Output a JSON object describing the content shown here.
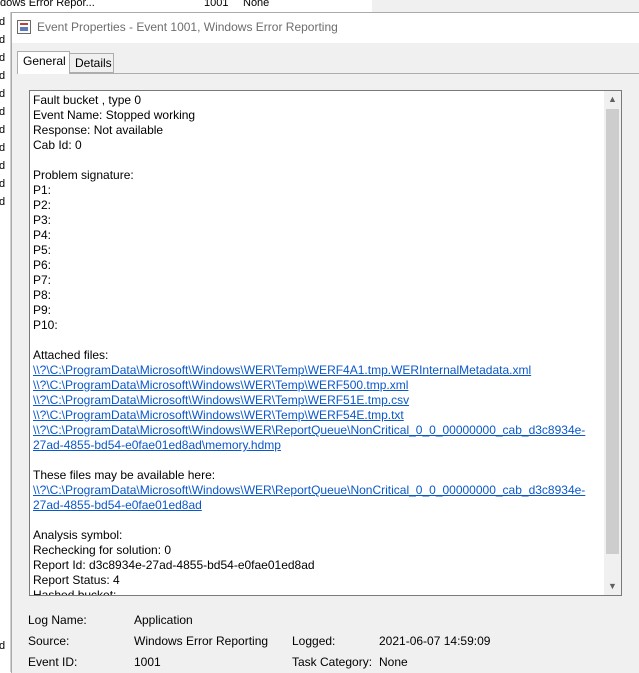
{
  "background": {
    "top_row": {
      "source": "dows Error Repor...",
      "id": "1001",
      "category": "None"
    },
    "left_fragments": [
      "d",
      "d",
      "d",
      "d",
      "d",
      "d",
      "d",
      "d",
      "d",
      "d",
      "d",
      "d"
    ]
  },
  "dialog": {
    "title": "Event Properties - Event 1001, Windows Error Reporting",
    "tabs": [
      {
        "label": "General",
        "active": true
      },
      {
        "label": "Details",
        "active": false
      }
    ]
  },
  "description": {
    "lines_a": [
      "Fault bucket , type 0",
      "Event Name: Stopped working",
      "Response: Not available",
      "Cab Id: 0"
    ],
    "signature_heading": "Problem signature:",
    "signature_lines": [
      "P1:",
      "P2:",
      "P3:",
      "P4:",
      "P5:",
      "P6:",
      "P7:",
      "P8:",
      "P9:",
      "P10:"
    ],
    "attached_heading": "Attached files:",
    "attached_links": [
      "\\\\?\\C:\\ProgramData\\Microsoft\\Windows\\WER\\Temp\\WERF4A1.tmp.WERInternalMetadata.xml",
      "\\\\?\\C:\\ProgramData\\Microsoft\\Windows\\WER\\Temp\\WERF500.tmp.xml",
      "\\\\?\\C:\\ProgramData\\Microsoft\\Windows\\WER\\Temp\\WERF51E.tmp.csv",
      "\\\\?\\C:\\ProgramData\\Microsoft\\Windows\\WER\\Temp\\WERF54E.tmp.txt",
      "\\\\?\\C:\\ProgramData\\Microsoft\\Windows\\WER\\ReportQueue\\NonCritical_0_0_00000000_cab_d3c8934e-",
      "27ad-4855-bd54-e0fae01ed8ad\\memory.hdmp"
    ],
    "available_heading": "These files may be available here:",
    "available_links": [
      "\\\\?\\C:\\ProgramData\\Microsoft\\Windows\\WER\\ReportQueue\\NonCritical_0_0_00000000_cab_d3c8934e-",
      "27ad-4855-bd54-e0fae01ed8ad"
    ],
    "lines_b": [
      "Analysis symbol:",
      "Rechecking for solution: 0",
      "Report Id: d3c8934e-27ad-4855-bd54-e0fae01ed8ad",
      "Report Status: 4",
      "Hashed bucket:"
    ]
  },
  "properties": {
    "log_name_label": "Log Name:",
    "log_name_value": "Application",
    "source_label": "Source:",
    "source_value": "Windows Error Reporting",
    "logged_label": "Logged:",
    "logged_value": "2021-06-07 14:59:09",
    "event_id_label": "Event ID:",
    "event_id_value": "1001",
    "task_category_label": "Task Category:",
    "task_category_value": "None"
  },
  "icons": {
    "title": "event-properties-icon",
    "scroll_up": "scroll-up-arrow-icon",
    "scroll_down": "scroll-down-arrow-icon"
  }
}
